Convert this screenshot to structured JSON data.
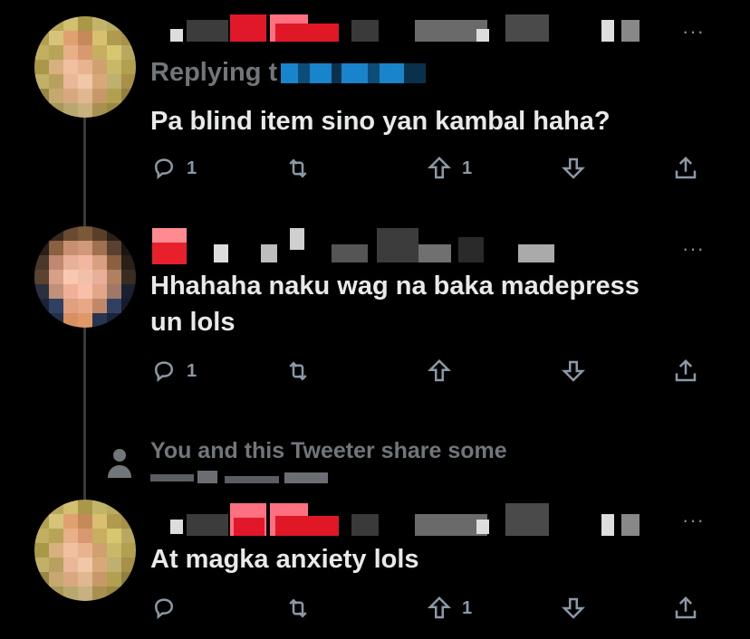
{
  "tweets": [
    {
      "reply_prefix": "Replying t",
      "text": "Pa blind item sino yan kambal haha?",
      "actions": {
        "reply_count": "1",
        "retweet_count": "",
        "upvote_count": "1"
      },
      "more": "···"
    },
    {
      "text_line1": "Hhahaha naku wag na baka madepress",
      "text_line2": "un lols",
      "actions": {
        "reply_count": "1",
        "retweet_count": "",
        "upvote_count": ""
      },
      "more": "···"
    },
    {
      "text": "At magka anxiety lols",
      "actions": {
        "reply_count": "",
        "retweet_count": "",
        "upvote_count": "1"
      },
      "more": "···"
    }
  ],
  "mutual_notice": "You and this Tweeter share some",
  "icons": [
    "reply-icon",
    "retweet-icon",
    "upvote-icon",
    "downvote-icon",
    "share-icon",
    "more-icon",
    "person-icon"
  ],
  "colors": {
    "background": "#000000",
    "text": "#e7e9ea",
    "muted": "#71767b",
    "icon": "#8b98a5"
  }
}
